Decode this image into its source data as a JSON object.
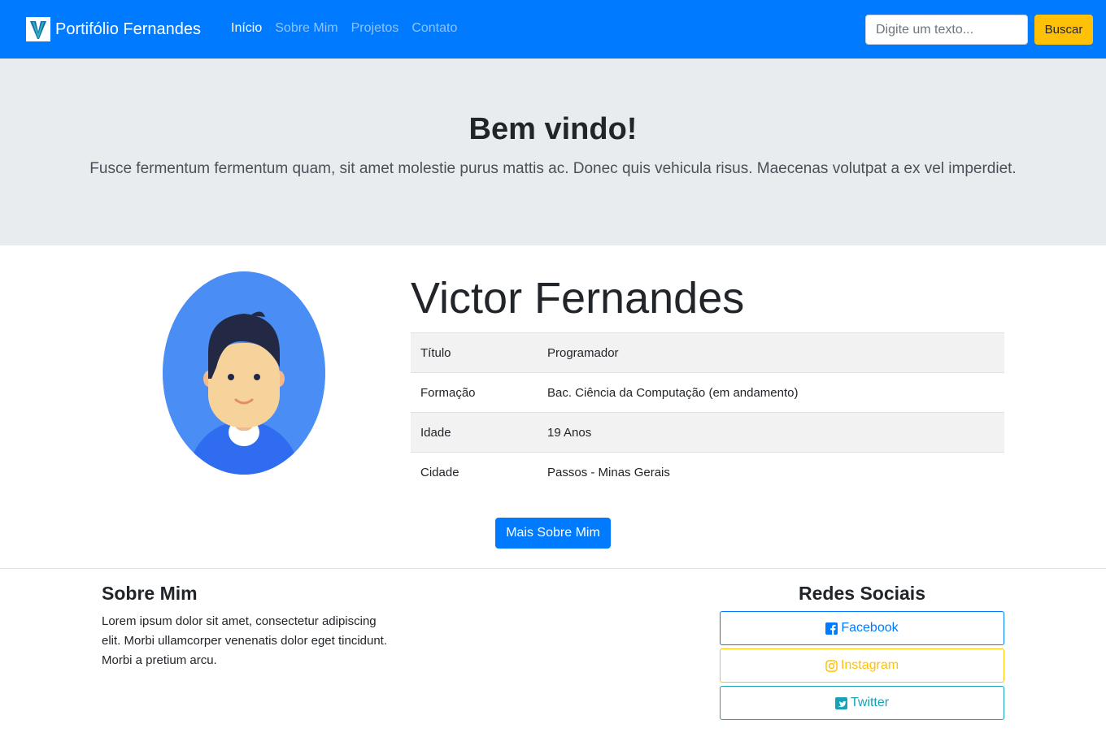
{
  "navbar": {
    "brand": "Portifólio Fernandes",
    "links": [
      "Início",
      "Sobre Mim",
      "Projetos",
      "Contato"
    ],
    "search_placeholder": "Digite um texto...",
    "search_button": "Buscar"
  },
  "hero": {
    "title": "Bem vindo!",
    "subtitle": "Fusce fermentum fermentum quam, sit amet molestie purus mattis ac. Donec quis vehicula risus. Maecenas volutpat a ex vel imperdiet."
  },
  "profile": {
    "name": "Victor Fernandes",
    "rows": [
      {
        "label": "Título",
        "value": "Programador"
      },
      {
        "label": "Formação",
        "value": "Bac. Ciência da Computação (em andamento)"
      },
      {
        "label": "Idade",
        "value": "19 Anos"
      },
      {
        "label": "Cidade",
        "value": "Passos - Minas Gerais"
      }
    ],
    "more_button": "Mais Sobre Mim"
  },
  "footer": {
    "about_title": "Sobre Mim",
    "about_text": "Lorem ipsum dolor sit amet, consectetur adipiscing elit. Morbi ullamcorper venenatis dolor eget tincidunt. Morbi a pretium arcu.",
    "social_title": "Redes Sociais",
    "social": [
      {
        "label": "Facebook",
        "icon": "facebook-icon"
      },
      {
        "label": "Instagram",
        "icon": "instagram-icon"
      },
      {
        "label": "Twitter",
        "icon": "twitter-icon"
      }
    ]
  },
  "colors": {
    "primary": "#007bff",
    "warning": "#ffc107",
    "info": "#17a2b8",
    "jumbotron": "#e9ecef"
  }
}
